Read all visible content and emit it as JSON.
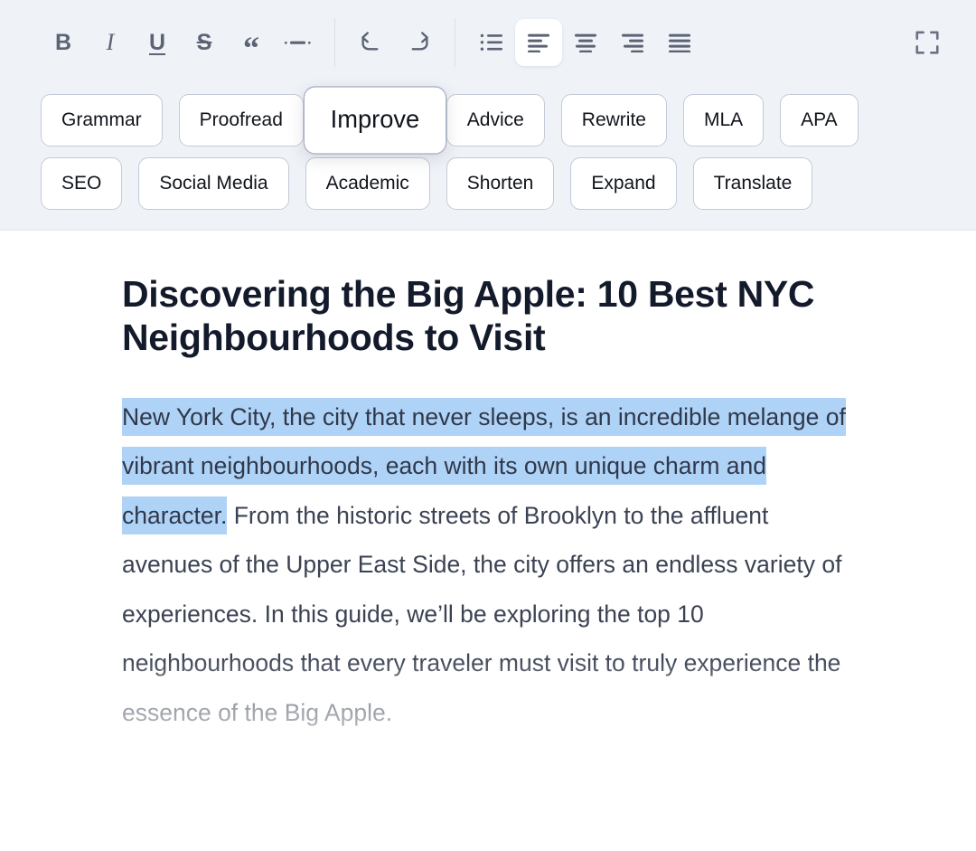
{
  "toolbar": {
    "groups": [
      {
        "name": "text-style",
        "buttons": [
          {
            "id": "bold",
            "icon": "bold-icon",
            "glyph": "B",
            "label": "Bold",
            "active": false
          },
          {
            "id": "italic",
            "icon": "italic-icon",
            "glyph": "I",
            "label": "Italic",
            "active": false
          },
          {
            "id": "underline",
            "icon": "underline-icon",
            "glyph": "U",
            "label": "Underline",
            "active": false
          },
          {
            "id": "strikethrough",
            "icon": "strikethrough-icon",
            "glyph": "S",
            "label": "Strikethrough",
            "active": false
          },
          {
            "id": "blockquote",
            "icon": "quote-icon",
            "glyph": "“",
            "label": "Quote",
            "active": false
          },
          {
            "id": "horizontal-rule",
            "icon": "horizontal-rule-icon",
            "glyph": "",
            "label": "Horizontal rule",
            "active": false
          }
        ]
      },
      {
        "name": "history",
        "buttons": [
          {
            "id": "undo",
            "icon": "undo-icon",
            "glyph": "",
            "label": "Undo",
            "active": false
          },
          {
            "id": "redo",
            "icon": "redo-icon",
            "glyph": "",
            "label": "Redo",
            "active": false
          }
        ]
      },
      {
        "name": "alignment",
        "buttons": [
          {
            "id": "bullet-list",
            "icon": "bullet-list-icon",
            "glyph": "",
            "label": "Bullet list",
            "active": false
          },
          {
            "id": "align-left",
            "icon": "align-left-icon",
            "glyph": "",
            "label": "Align left",
            "active": true
          },
          {
            "id": "align-center",
            "icon": "align-center-icon",
            "glyph": "",
            "label": "Align center",
            "active": false
          },
          {
            "id": "align-right",
            "icon": "align-right-icon",
            "glyph": "",
            "label": "Align right",
            "active": false
          },
          {
            "id": "align-justify",
            "icon": "align-justify-icon",
            "glyph": "",
            "label": "Justify",
            "active": false
          }
        ]
      }
    ],
    "fullscreen": {
      "id": "fullscreen",
      "icon": "fullscreen-icon",
      "label": "Fullscreen"
    },
    "colors": {
      "bar_background": "#eff2f7",
      "icon": "#5c6374",
      "active_background": "#ffffff",
      "separator": "#dbe1ea"
    }
  },
  "ai_actions": {
    "row1": [
      {
        "label": "Grammar",
        "hovered": false
      },
      {
        "label": "Proofread",
        "hovered": false
      },
      {
        "label": "Improve",
        "hovered": true
      },
      {
        "label": "Advice",
        "hovered": false
      },
      {
        "label": "Rewrite",
        "hovered": false
      },
      {
        "label": "MLA",
        "hovered": false
      },
      {
        "label": "APA",
        "hovered": false
      }
    ],
    "row2": [
      {
        "label": "SEO",
        "hovered": false
      },
      {
        "label": "Social Media",
        "hovered": false
      },
      {
        "label": "Academic",
        "hovered": false
      },
      {
        "label": "Shorten",
        "hovered": false
      },
      {
        "label": "Expand",
        "hovered": false
      },
      {
        "label": "Translate",
        "hovered": false
      }
    ],
    "colors": {
      "button_background": "#ffffff",
      "button_border": "#c3cbd9",
      "button_text": "#11141c"
    }
  },
  "document": {
    "title": "Discovering the Big Apple: 10 Best NYC Neighbourhoods to Visit",
    "paragraph": {
      "selected_text": "New York City, the city that never sleeps, is an incredible melange of vibrant neighbourhoods, each with its own unique charm and character.",
      "rest_text": " From the historic streets of Brooklyn to the affluent avenues of the Upper East Side, the city offers an endless variety of experiences. In this guide, we’ll be exploring the top 10 neighbourhoods that every traveler must visit to truly experience the essence of the Big Apple."
    },
    "colors": {
      "page_background": "#ffffff",
      "title_text": "#131a2b",
      "body_text": "#3b4253",
      "selection_highlight": "#aed3f7"
    }
  }
}
